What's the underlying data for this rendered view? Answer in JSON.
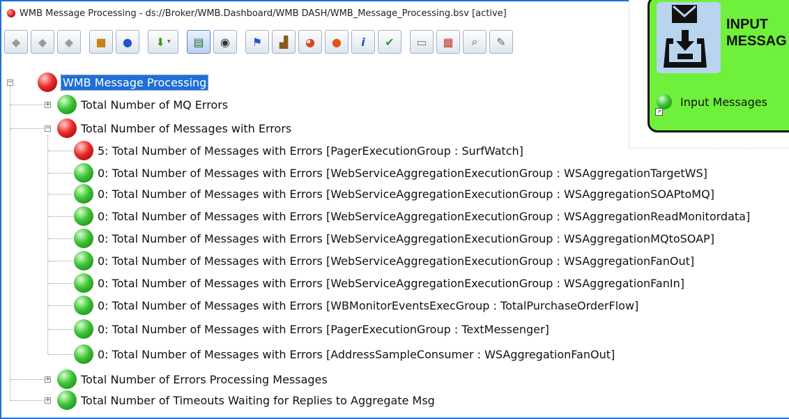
{
  "window": {
    "title": "WMB Message Processing - ds://Broker/WMB.Dashboard/WMB DASH/WMB_Message_Processing.bsv [active]"
  },
  "toolbar": {
    "buttons": [
      {
        "name": "grey-diamond-1-icon"
      },
      {
        "name": "grey-diamond-2-icon"
      },
      {
        "name": "grey-diamond-3-icon"
      },
      {
        "name": "package-icon"
      },
      {
        "name": "stop-icon"
      },
      {
        "name": "download-arrow-dropdown-icon"
      },
      {
        "name": "tree-view-icon"
      },
      {
        "name": "gauge-icon"
      },
      {
        "name": "flag-icon"
      },
      {
        "name": "chart-icon"
      },
      {
        "name": "pie-chart-icon"
      },
      {
        "name": "alarm-icon"
      },
      {
        "name": "info-icon"
      },
      {
        "name": "checkmark-icon"
      },
      {
        "name": "book-icon"
      },
      {
        "name": "calendar-icon"
      },
      {
        "name": "search-document-icon"
      },
      {
        "name": "tools-icon"
      }
    ]
  },
  "tree": {
    "root": {
      "label": "WMB Message Processing",
      "status": "red"
    },
    "groups": [
      {
        "label": "Total Number of MQ Errors",
        "status": "green",
        "expanded": false
      },
      {
        "label": "Total Number of Messages with Errors",
        "status": "red",
        "expanded": true,
        "children": [
          {
            "label": "5: Total Number of Messages with Errors [PagerExecutionGroup : SurfWatch]",
            "status": "red"
          },
          {
            "label": "0: Total Number of Messages with Errors [WebServiceAggregationExecutionGroup : WSAggregationTargetWS]",
            "status": "green"
          },
          {
            "label": "0: Total Number of Messages with Errors [WebServiceAggregationExecutionGroup : WSAggregationSOAPtoMQ]",
            "status": "green"
          },
          {
            "label": "0: Total Number of Messages with Errors [WebServiceAggregationExecutionGroup : WSAggregationReadMonitordata]",
            "status": "green"
          },
          {
            "label": "0: Total Number of Messages with Errors [WebServiceAggregationExecutionGroup : WSAggregationMQtoSOAP]",
            "status": "green"
          },
          {
            "label": "0: Total Number of Messages with Errors [WebServiceAggregationExecutionGroup : WSAggregationFanOut]",
            "status": "green"
          },
          {
            "label": "0: Total Number of Messages with Errors [WebServiceAggregationExecutionGroup : WSAggregationFanIn]",
            "status": "green"
          },
          {
            "label": "0: Total Number of Messages with Errors [WBMonitorEventsExecGroup : TotalPurchaseOrderFlow]",
            "status": "green"
          },
          {
            "label": "0: Total Number of Messages with Errors [PagerExecutionGroup : TextMessenger]",
            "status": "green"
          },
          {
            "label": "0: Total Number of Messages with Errors [AddressSampleConsumer : WSAggregationFanOut]",
            "status": "green"
          }
        ]
      },
      {
        "label": "Total Number of Errors Processing Messages",
        "status": "green",
        "expanded": false
      },
      {
        "label": "Total Number of Timeouts Waiting for Replies to Aggregate Msg",
        "status": "green",
        "expanded": false
      }
    ]
  },
  "tile": {
    "title_line1": "INPUT",
    "title_line2": "MESSAG",
    "footer_label": "Input Messages",
    "footer_status": "green",
    "background": "#6ff03a"
  }
}
